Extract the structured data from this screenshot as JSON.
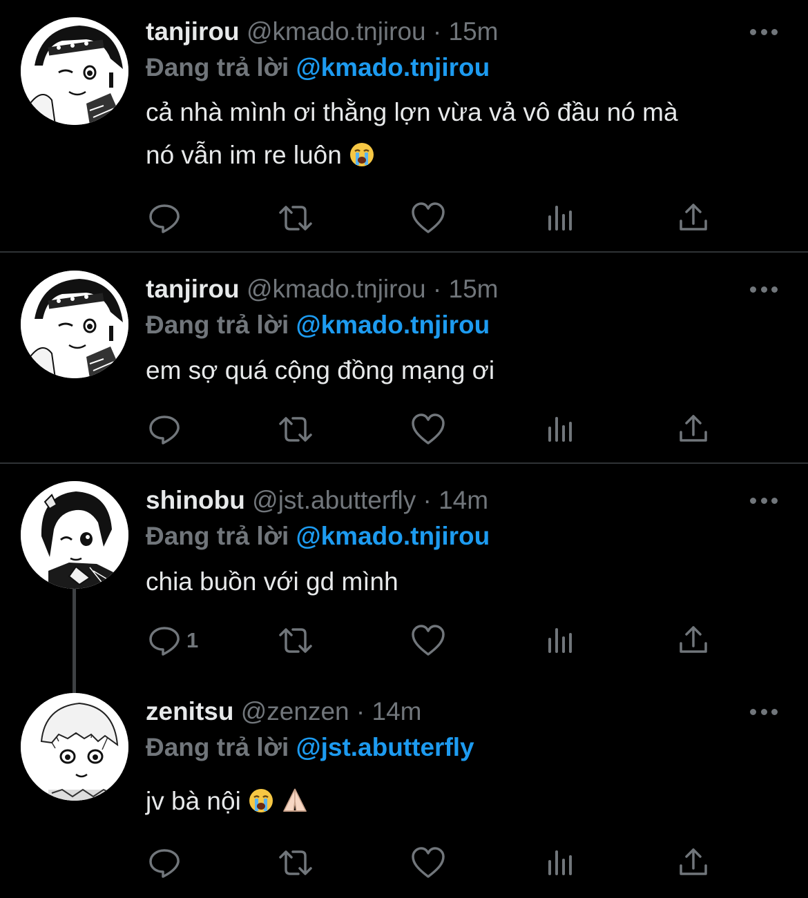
{
  "colors": {
    "background": "#000000",
    "text": "#e7e9ea",
    "muted": "#71767b",
    "accent": "#1d9bf0",
    "divider": "#2f3336"
  },
  "tweets": [
    {
      "name": "tanjirou",
      "handle": "@kmado.tnjirou",
      "separator": "·",
      "time": "15m",
      "replying_label": "Đang trả lời",
      "replying_to": "@kmado.tnjirou",
      "text_lines": [
        "cả nhà mình ơi thằng lợn vừa vả vô đầu nó mà",
        "nó vẫn im re luôn"
      ],
      "emoji": [
        "loudly-crying-face"
      ],
      "reply_count": "",
      "avatar": "anime-avatar-tanjirou"
    },
    {
      "name": "tanjirou",
      "handle": "@kmado.tnjirou",
      "separator": "·",
      "time": "15m",
      "replying_label": "Đang trả lời",
      "replying_to": "@kmado.tnjirou",
      "text_lines": [
        "em sợ quá cộng đồng mạng ơi"
      ],
      "emoji": [],
      "reply_count": "",
      "avatar": "anime-avatar-tanjirou"
    },
    {
      "name": "shinobu",
      "handle": "@jst.abutterfly",
      "separator": "·",
      "time": "14m",
      "replying_label": "Đang trả lời",
      "replying_to": "@kmado.tnjirou",
      "text_lines": [
        "chia buồn với gd mình"
      ],
      "emoji": [],
      "reply_count": "1",
      "avatar": "anime-avatar-shinobu"
    },
    {
      "name": "zenitsu",
      "handle": "@zenzen",
      "separator": "·",
      "time": "14m",
      "replying_label": "Đang trả lời",
      "replying_to": "@jst.abutterfly",
      "text_lines": [
        "jv bà nội"
      ],
      "emoji": [
        "loudly-crying-face",
        "folded-hands"
      ],
      "reply_count": "",
      "avatar": "anime-avatar-zenitsu"
    }
  ],
  "action_icons": [
    "reply-icon",
    "retweet-icon",
    "like-icon",
    "views-icon",
    "share-icon"
  ]
}
